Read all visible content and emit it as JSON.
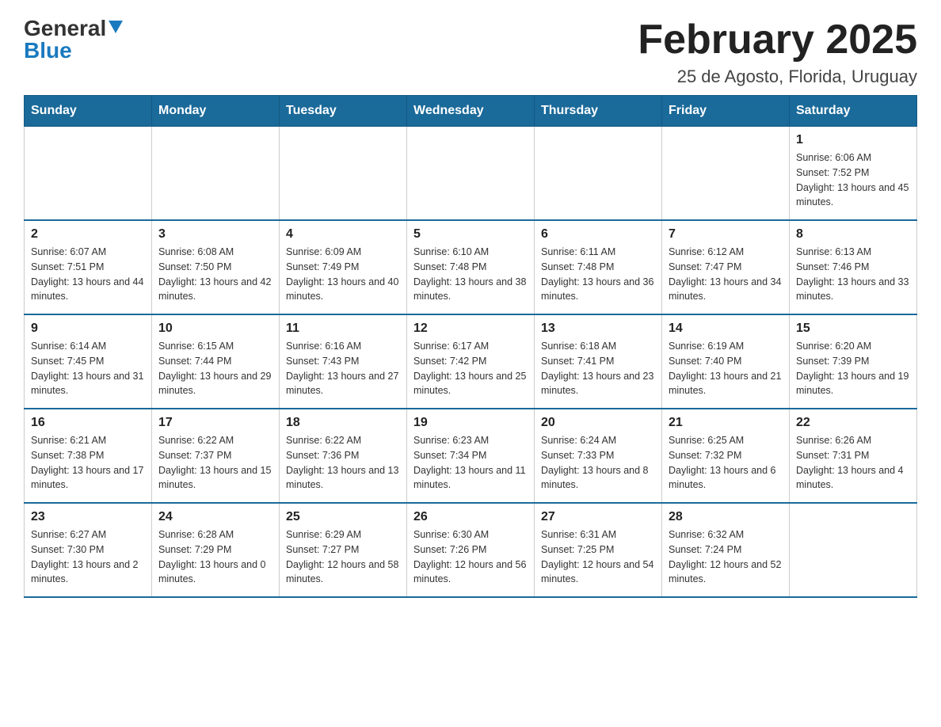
{
  "header": {
    "logo_part1": "General",
    "logo_part2": "Blue",
    "month_title": "February 2025",
    "subtitle": "25 de Agosto, Florida, Uruguay"
  },
  "days_of_week": [
    "Sunday",
    "Monday",
    "Tuesday",
    "Wednesday",
    "Thursday",
    "Friday",
    "Saturday"
  ],
  "weeks": [
    {
      "days": [
        {
          "number": "",
          "info": ""
        },
        {
          "number": "",
          "info": ""
        },
        {
          "number": "",
          "info": ""
        },
        {
          "number": "",
          "info": ""
        },
        {
          "number": "",
          "info": ""
        },
        {
          "number": "",
          "info": ""
        },
        {
          "number": "1",
          "info": "Sunrise: 6:06 AM\nSunset: 7:52 PM\nDaylight: 13 hours and 45 minutes."
        }
      ]
    },
    {
      "days": [
        {
          "number": "2",
          "info": "Sunrise: 6:07 AM\nSunset: 7:51 PM\nDaylight: 13 hours and 44 minutes."
        },
        {
          "number": "3",
          "info": "Sunrise: 6:08 AM\nSunset: 7:50 PM\nDaylight: 13 hours and 42 minutes."
        },
        {
          "number": "4",
          "info": "Sunrise: 6:09 AM\nSunset: 7:49 PM\nDaylight: 13 hours and 40 minutes."
        },
        {
          "number": "5",
          "info": "Sunrise: 6:10 AM\nSunset: 7:48 PM\nDaylight: 13 hours and 38 minutes."
        },
        {
          "number": "6",
          "info": "Sunrise: 6:11 AM\nSunset: 7:48 PM\nDaylight: 13 hours and 36 minutes."
        },
        {
          "number": "7",
          "info": "Sunrise: 6:12 AM\nSunset: 7:47 PM\nDaylight: 13 hours and 34 minutes."
        },
        {
          "number": "8",
          "info": "Sunrise: 6:13 AM\nSunset: 7:46 PM\nDaylight: 13 hours and 33 minutes."
        }
      ]
    },
    {
      "days": [
        {
          "number": "9",
          "info": "Sunrise: 6:14 AM\nSunset: 7:45 PM\nDaylight: 13 hours and 31 minutes."
        },
        {
          "number": "10",
          "info": "Sunrise: 6:15 AM\nSunset: 7:44 PM\nDaylight: 13 hours and 29 minutes."
        },
        {
          "number": "11",
          "info": "Sunrise: 6:16 AM\nSunset: 7:43 PM\nDaylight: 13 hours and 27 minutes."
        },
        {
          "number": "12",
          "info": "Sunrise: 6:17 AM\nSunset: 7:42 PM\nDaylight: 13 hours and 25 minutes."
        },
        {
          "number": "13",
          "info": "Sunrise: 6:18 AM\nSunset: 7:41 PM\nDaylight: 13 hours and 23 minutes."
        },
        {
          "number": "14",
          "info": "Sunrise: 6:19 AM\nSunset: 7:40 PM\nDaylight: 13 hours and 21 minutes."
        },
        {
          "number": "15",
          "info": "Sunrise: 6:20 AM\nSunset: 7:39 PM\nDaylight: 13 hours and 19 minutes."
        }
      ]
    },
    {
      "days": [
        {
          "number": "16",
          "info": "Sunrise: 6:21 AM\nSunset: 7:38 PM\nDaylight: 13 hours and 17 minutes."
        },
        {
          "number": "17",
          "info": "Sunrise: 6:22 AM\nSunset: 7:37 PM\nDaylight: 13 hours and 15 minutes."
        },
        {
          "number": "18",
          "info": "Sunrise: 6:22 AM\nSunset: 7:36 PM\nDaylight: 13 hours and 13 minutes."
        },
        {
          "number": "19",
          "info": "Sunrise: 6:23 AM\nSunset: 7:34 PM\nDaylight: 13 hours and 11 minutes."
        },
        {
          "number": "20",
          "info": "Sunrise: 6:24 AM\nSunset: 7:33 PM\nDaylight: 13 hours and 8 minutes."
        },
        {
          "number": "21",
          "info": "Sunrise: 6:25 AM\nSunset: 7:32 PM\nDaylight: 13 hours and 6 minutes."
        },
        {
          "number": "22",
          "info": "Sunrise: 6:26 AM\nSunset: 7:31 PM\nDaylight: 13 hours and 4 minutes."
        }
      ]
    },
    {
      "days": [
        {
          "number": "23",
          "info": "Sunrise: 6:27 AM\nSunset: 7:30 PM\nDaylight: 13 hours and 2 minutes."
        },
        {
          "number": "24",
          "info": "Sunrise: 6:28 AM\nSunset: 7:29 PM\nDaylight: 13 hours and 0 minutes."
        },
        {
          "number": "25",
          "info": "Sunrise: 6:29 AM\nSunset: 7:27 PM\nDaylight: 12 hours and 58 minutes."
        },
        {
          "number": "26",
          "info": "Sunrise: 6:30 AM\nSunset: 7:26 PM\nDaylight: 12 hours and 56 minutes."
        },
        {
          "number": "27",
          "info": "Sunrise: 6:31 AM\nSunset: 7:25 PM\nDaylight: 12 hours and 54 minutes."
        },
        {
          "number": "28",
          "info": "Sunrise: 6:32 AM\nSunset: 7:24 PM\nDaylight: 12 hours and 52 minutes."
        },
        {
          "number": "",
          "info": ""
        }
      ]
    }
  ]
}
